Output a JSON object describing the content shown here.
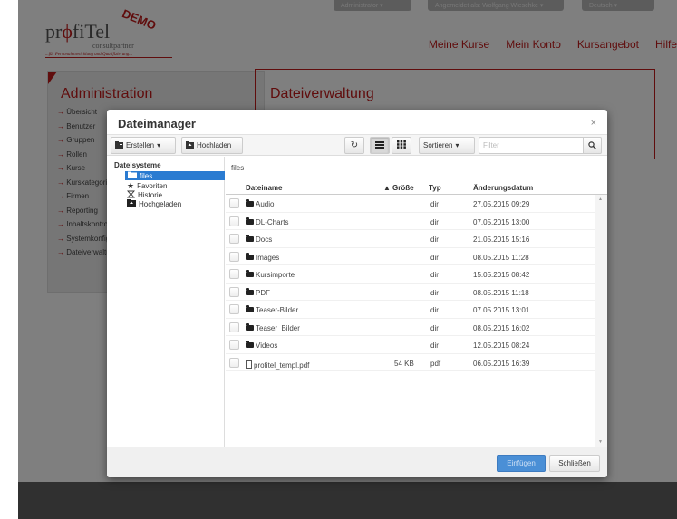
{
  "background": {
    "top_pills": [
      "Administrator ▾",
      "Angemeldet als: Wolfgang Wieschke ▾",
      "Deutsch ▾"
    ],
    "logo": {
      "text_pre": "pr",
      "text_phi": "ϕ",
      "text_post": "fiTel",
      "sub": "consultpartner",
      "demo": "DEMO",
      "tagline": "...für Personalentwicklung und Qualifizierung..."
    },
    "nav": [
      "Meine Kurse",
      "Mein Konto",
      "Kursangebot",
      "Hilfe"
    ],
    "admin_title": "Administration",
    "admin_menu": [
      "Übersicht",
      "Benutzer",
      "Gruppen",
      "Rollen",
      "Kurse",
      "Kurskategorien",
      "Firmen",
      "Reporting",
      "Inhaltskontrolle",
      "Systemkonfiguration",
      "Dateiverwaltung"
    ],
    "section_title": "Dateiverwaltung"
  },
  "modal": {
    "title": "Dateimanager",
    "close": "×",
    "toolbar": {
      "create": "Erstellen",
      "upload": "Hochladen",
      "sort": "Sortieren",
      "filter_placeholder": "Filter"
    },
    "sidebar": {
      "heading": "Dateisysteme",
      "items": [
        {
          "label": "files",
          "icon": "folder-icon"
        },
        {
          "label": "Favoriten",
          "icon": "star-icon"
        },
        {
          "label": "Historie",
          "icon": "history-icon"
        },
        {
          "label": "Hochgeladen",
          "icon": "upload-icon"
        }
      ]
    },
    "path": "files",
    "columns": {
      "name": "Dateiname",
      "size": "Größe",
      "type": "Typ",
      "date": "Änderungsdatum"
    },
    "rows": [
      {
        "name": "Audio",
        "size": "",
        "type": "dir",
        "date": "27.05.2015 09:29",
        "kind": "folder"
      },
      {
        "name": "DL-Charts",
        "size": "",
        "type": "dir",
        "date": "07.05.2015 13:00",
        "kind": "folder"
      },
      {
        "name": "Docs",
        "size": "",
        "type": "dir",
        "date": "21.05.2015 15:16",
        "kind": "folder"
      },
      {
        "name": "Images",
        "size": "",
        "type": "dir",
        "date": "08.05.2015 11:28",
        "kind": "folder"
      },
      {
        "name": "Kursimporte",
        "size": "",
        "type": "dir",
        "date": "15.05.2015 08:42",
        "kind": "folder"
      },
      {
        "name": "PDF",
        "size": "",
        "type": "dir",
        "date": "08.05.2015 11:18",
        "kind": "folder"
      },
      {
        "name": "Teaser-Bilder",
        "size": "",
        "type": "dir",
        "date": "07.05.2015 13:01",
        "kind": "folder"
      },
      {
        "name": "Teaser_Bilder",
        "size": "",
        "type": "dir",
        "date": "08.05.2015 16:02",
        "kind": "folder"
      },
      {
        "name": "Videos",
        "size": "",
        "type": "dir",
        "date": "12.05.2015 08:24",
        "kind": "folder"
      },
      {
        "name": "profitel_templ.pdf",
        "size": "54 KB",
        "type": "pdf",
        "date": "06.05.2015 16:39",
        "kind": "file"
      }
    ],
    "footer": {
      "insert": "Einfügen",
      "close": "Schließen"
    }
  },
  "colors": {
    "brand_red": "#c01a1a",
    "selected_blue": "#2a7bd1",
    "primary_button": "#4a8fd6"
  }
}
